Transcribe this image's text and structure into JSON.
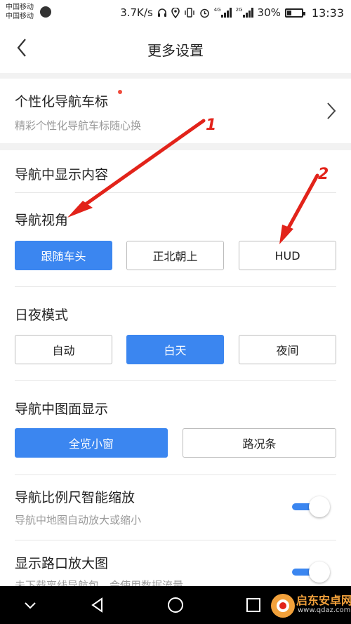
{
  "status_bar": {
    "carrier_1": "中国移动",
    "carrier_2": "中国移动",
    "net_speed": "3.7K/s",
    "network_1": "4G",
    "network_2": "2G",
    "battery": "30%",
    "battery_level": 0.3,
    "time": "13:33"
  },
  "header": {
    "title": "更多设置",
    "back_icon": "chevron-left-icon"
  },
  "personal_icon": {
    "title": "个性化导航车标",
    "subtitle": "精彩个性化导航车标随心换",
    "has_red_dot": true
  },
  "section_title": "导航中显示内容",
  "nav_view": {
    "label": "导航视角",
    "options": [
      "跟随车头",
      "正北朝上",
      "HUD"
    ],
    "selected": "跟随车头"
  },
  "day_night": {
    "label": "日夜模式",
    "options": [
      "自动",
      "白天",
      "夜间"
    ],
    "selected": "白天"
  },
  "map_display": {
    "label": "导航中图面显示",
    "options": [
      "全览小窗",
      "路况条"
    ],
    "selected": "全览小窗"
  },
  "smart_zoom": {
    "title": "导航比例尺智能缩放",
    "subtitle": "导航中地图自动放大或缩小",
    "enabled": true
  },
  "junction": {
    "title": "显示路口放大图",
    "subtitle": "未下载离线导航包，会使用数据流量",
    "enabled": true
  },
  "annotations": [
    "1",
    "2"
  ],
  "watermark": {
    "text": "启东安卓网",
    "url": "www.qdaz.com"
  },
  "colors": {
    "accent": "#3b86f0",
    "annotation": "#e2231a",
    "dot": "#f04b3c"
  }
}
